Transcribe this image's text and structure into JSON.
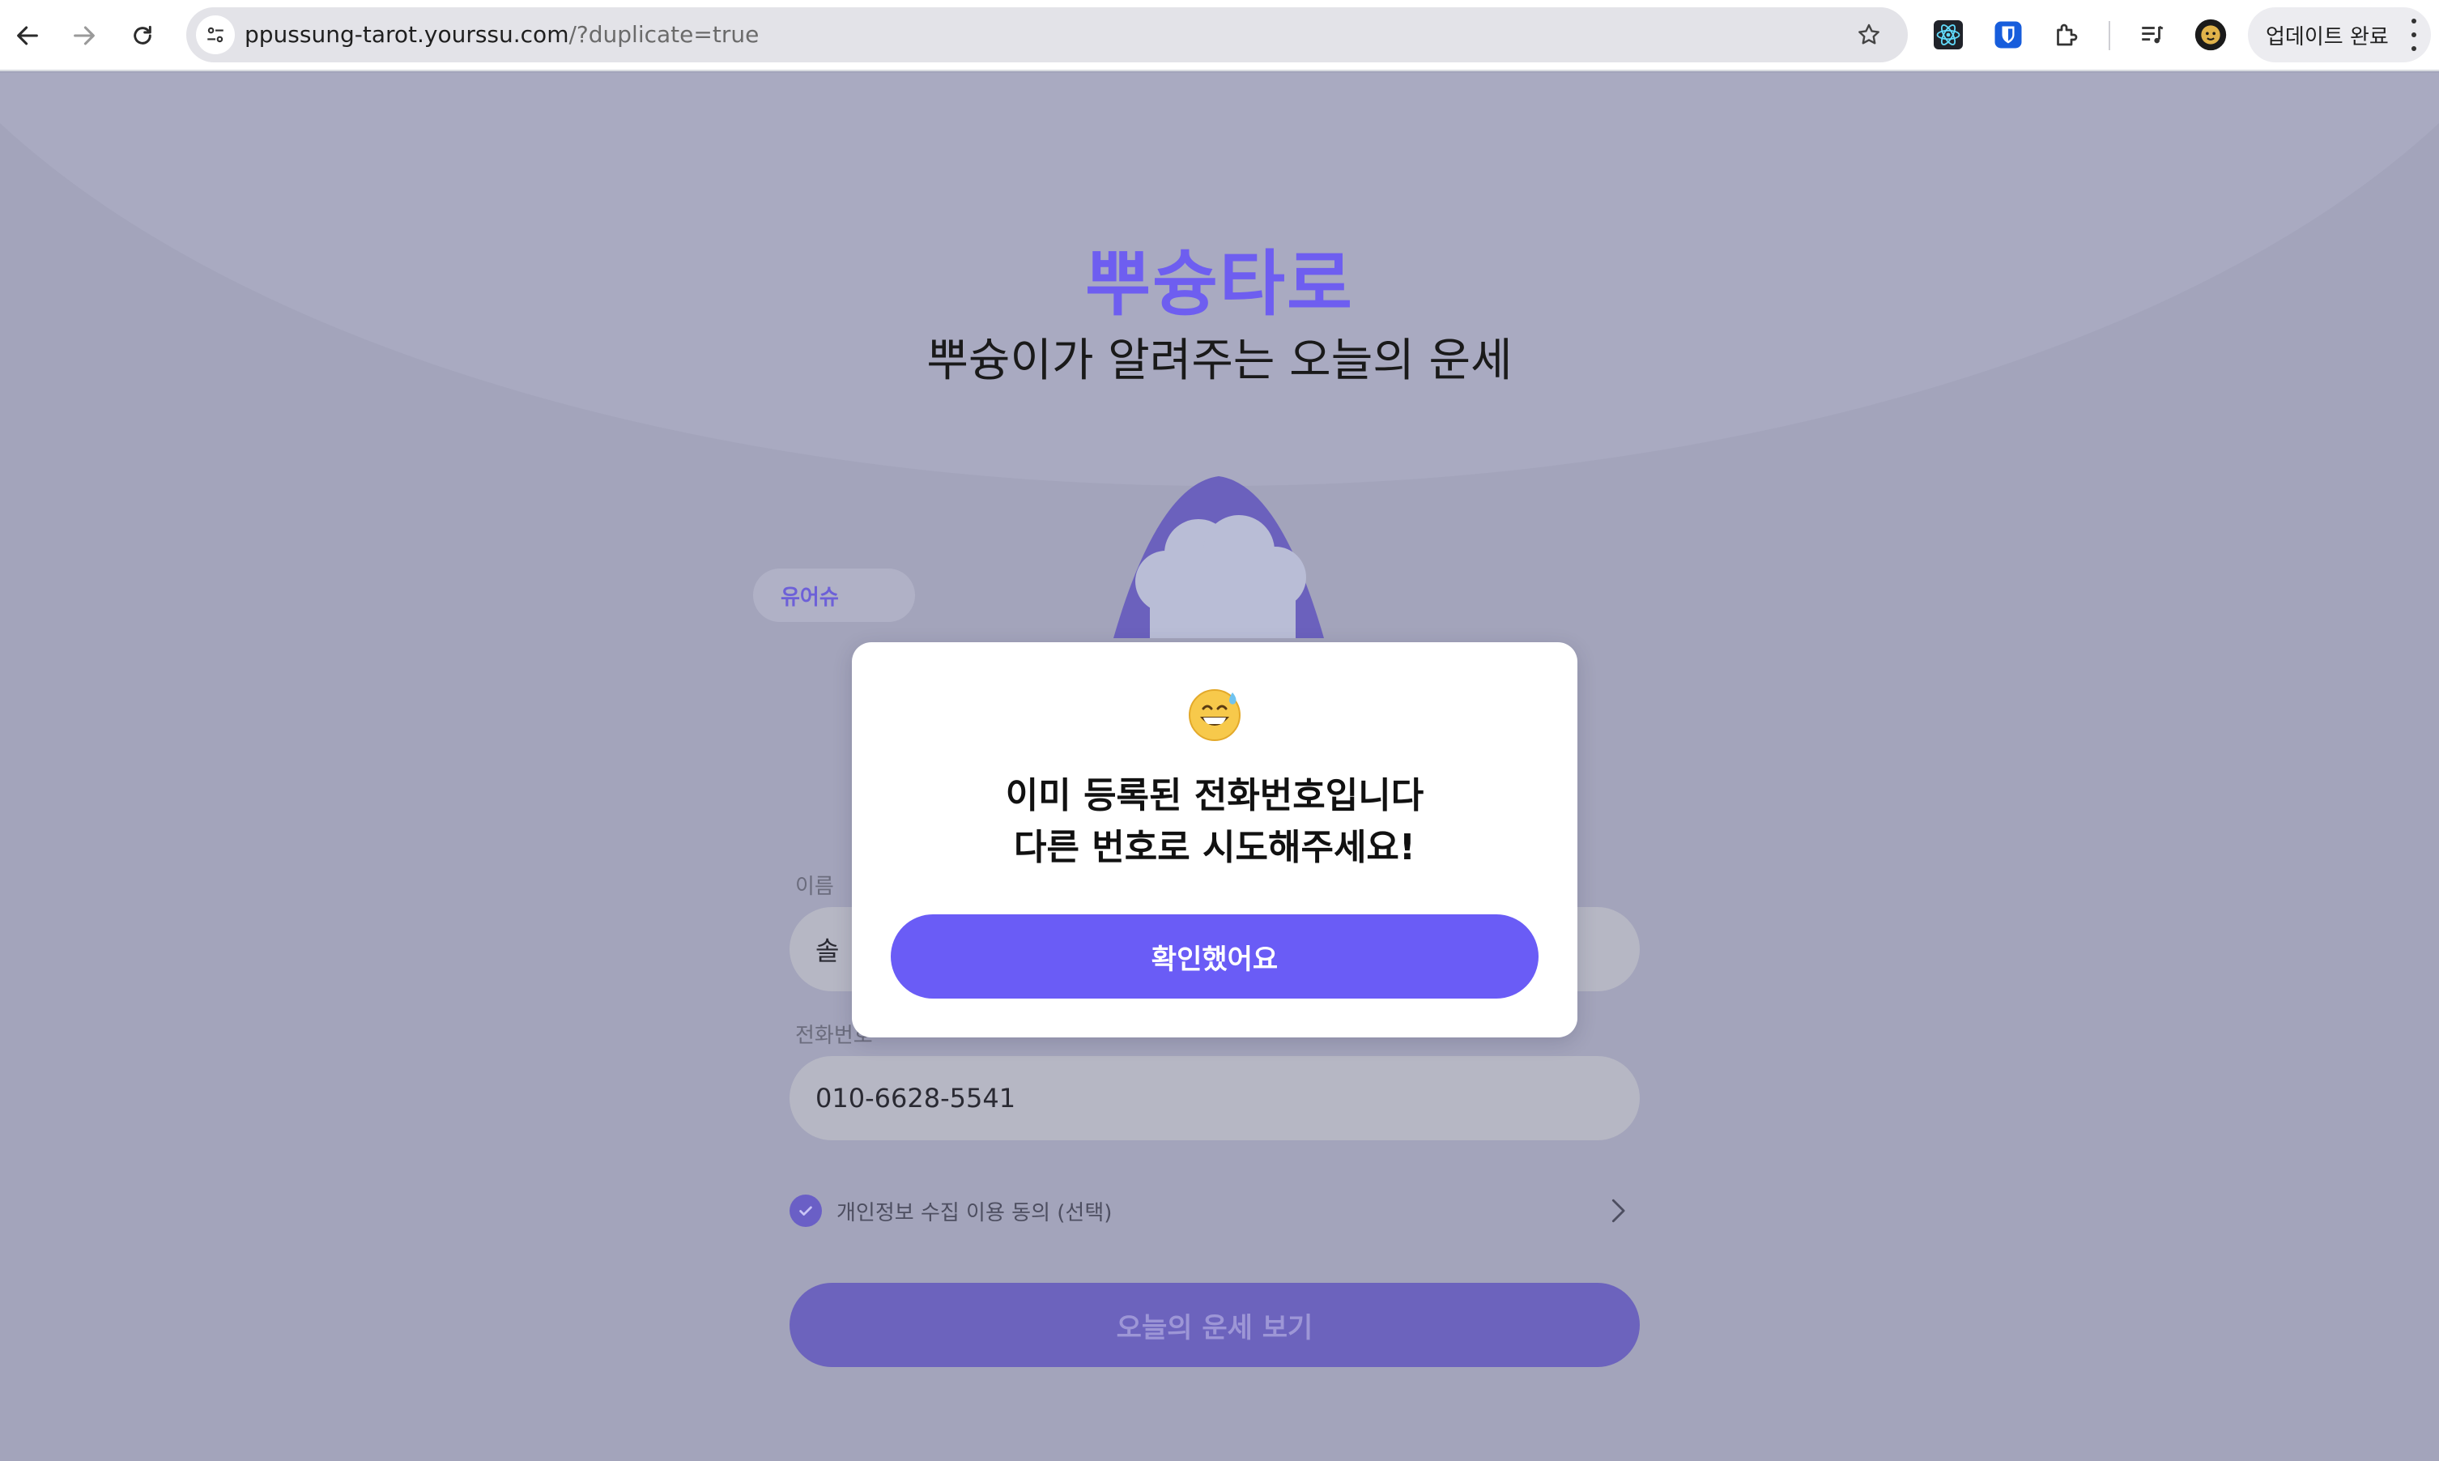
{
  "browser": {
    "url_host": "ppussung-tarot.yourssu.com",
    "url_path": "/?duplicate=true",
    "update_button_label": "업데이트 완료"
  },
  "page": {
    "brand_title": "뿌슝타로",
    "tagline": "뿌슝이가 알려주는 오늘의 운세",
    "chip_label": "유어슈",
    "name_label": "이름",
    "name_value": "솔",
    "phone_label": "전화번호",
    "phone_value": "010-6628-5541",
    "consent_label": "개인정보 수집 이용 동의 (선택)",
    "consent_checked": true,
    "submit_label": "오늘의 운세 보기"
  },
  "modal": {
    "emoji": "grinning-sweat-emoji",
    "message_line1": "이미 등록된 전화번호입니다",
    "message_line2": "다른 번호로 시도해주세요!",
    "confirm_label": "확인했어요"
  },
  "colors": {
    "brand": "#6e5ef0",
    "primary_button": "#6a5cf6",
    "overlay_background": "#a3a4bb"
  }
}
